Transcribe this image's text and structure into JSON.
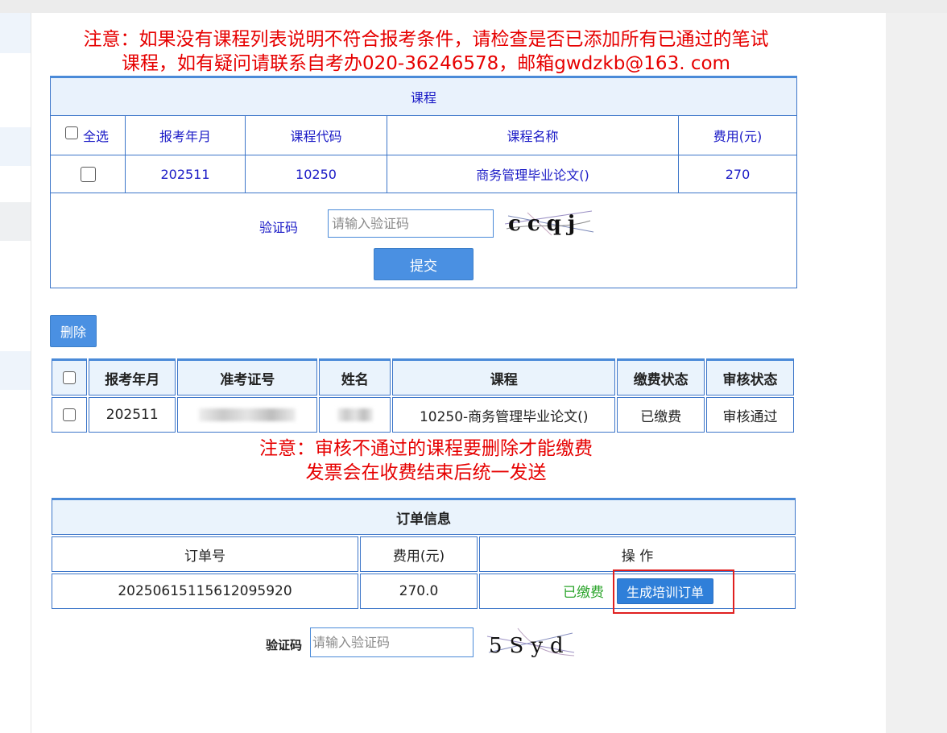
{
  "notice_top": [
    "注意：如果没有课程列表说明不符合报考条件，请检查是否已添加所有已通过的笔试",
    "课程，如有疑问请联系自考办020-36246578，邮箱gwdzkb@163. com"
  ],
  "course_table": {
    "title": "课程",
    "select_all": "全选",
    "headers": [
      "报考年月",
      "课程代码",
      "课程名称",
      "费用(元)"
    ],
    "rows": [
      {
        "month": "202511",
        "code": "10250",
        "name": "商务管理毕业论文()",
        "fee": "270"
      }
    ]
  },
  "captcha1": {
    "label": "验证码",
    "placeholder": "请输入验证码",
    "image_text": "ccqj"
  },
  "submit_label": "提交",
  "delete_label": "删除",
  "reg_table": {
    "headers": [
      "报考年月",
      "准考证号",
      "姓名",
      "课程",
      "缴费状态",
      "审核状态"
    ],
    "rows": [
      {
        "month": "202511",
        "course": "10250-商务管理毕业论文()",
        "pay_status": "已缴费",
        "review_status": "审核通过"
      }
    ]
  },
  "notice_mid": [
    "注意：审核不通过的课程要删除才能缴费",
    "发票会在收费结束后统一发送"
  ],
  "order_table": {
    "title": "订单信息",
    "headers": [
      "订单号",
      "费用(元)",
      "操 作"
    ],
    "rows": [
      {
        "order_no": "20250615115612095920",
        "fee": "270.0",
        "paid": "已缴费",
        "action": "生成培训订单"
      }
    ]
  },
  "captcha2": {
    "label": "验证码",
    "placeholder": "请输入验证码",
    "image_text": "5Syd"
  }
}
